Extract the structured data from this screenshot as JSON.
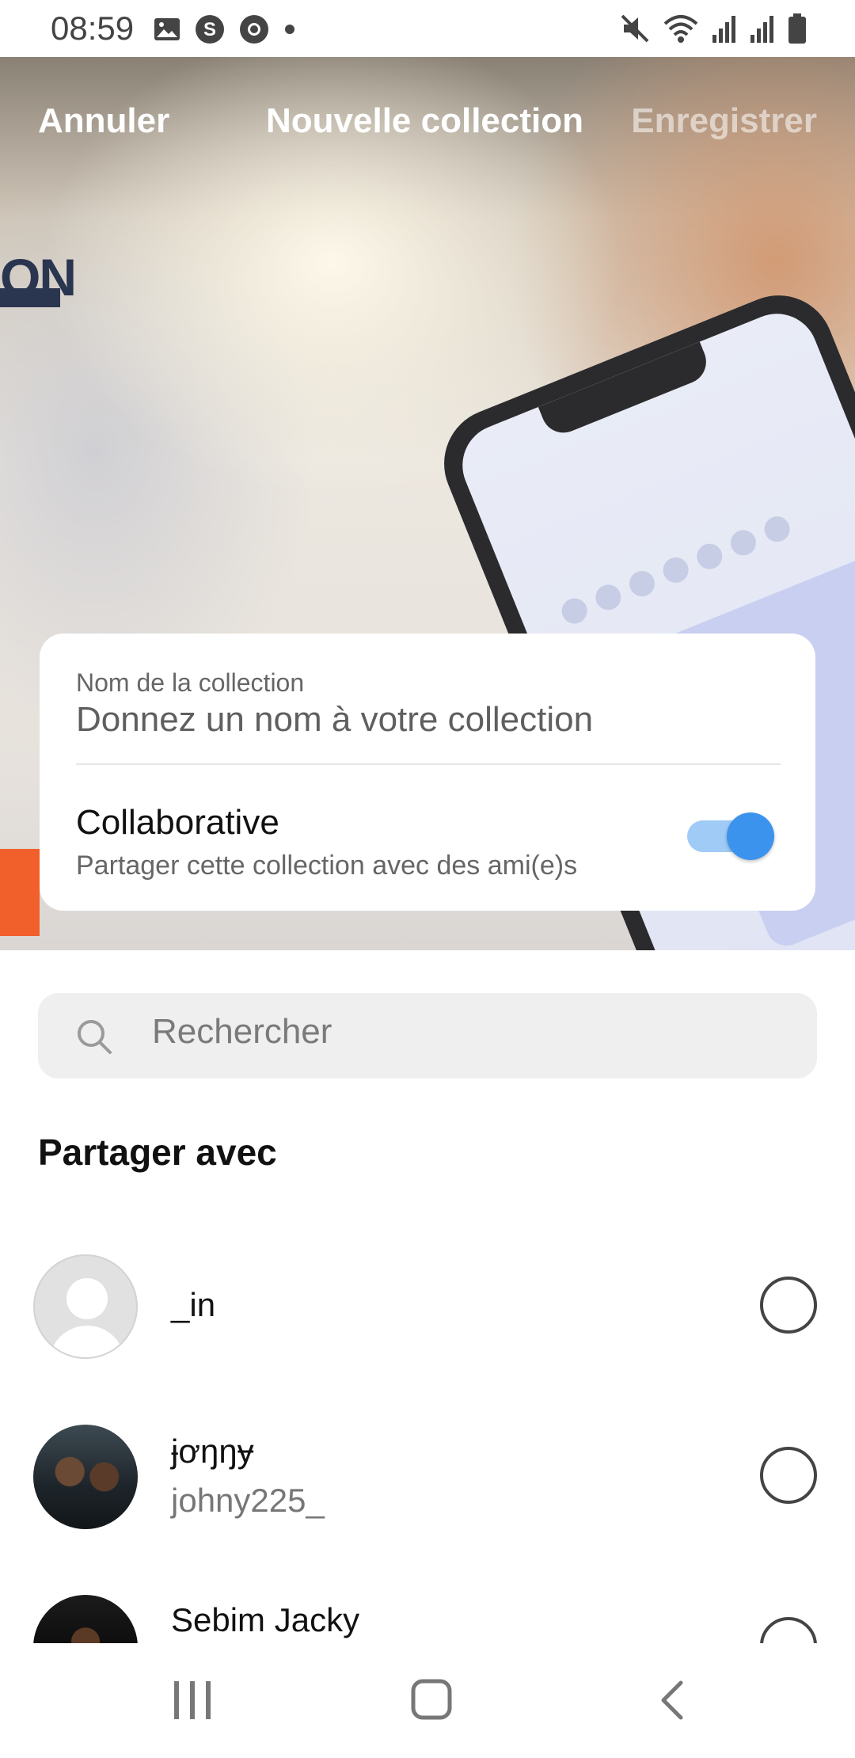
{
  "status_bar": {
    "time": "08:59",
    "left_icons": [
      "image-icon",
      "s-app-icon",
      "chrome-icon",
      "dot-icon"
    ],
    "right_icons": [
      "mute-icon",
      "wifi-icon",
      "signal-icon",
      "signal-icon",
      "battery-icon"
    ]
  },
  "header": {
    "cancel_label": "Annuler",
    "title": "Nouvelle collection",
    "save_label": "Enregistrer"
  },
  "form": {
    "name_label": "Nom de la collection",
    "name_placeholder": "Donnez un nom à votre collection",
    "name_value": "",
    "collaborative_title": "Collaborative",
    "collaborative_subtitle": "Partager cette collection avec des ami(e)s",
    "collaborative_on": true
  },
  "search": {
    "placeholder": "Rechercher"
  },
  "share_section": {
    "title": "Partager avec",
    "contacts": [
      {
        "name": "_in",
        "handle": "",
        "avatar": "default-avatar",
        "selected": false
      },
      {
        "name": "ɉơŋŋɏ",
        "handle": "johny225_",
        "avatar": "photo-avatar",
        "selected": false
      },
      {
        "name": "Sebim Jacky",
        "handle": "",
        "avatar": "photo-avatar",
        "selected": false
      }
    ]
  },
  "colors": {
    "accent": "#3b93ee",
    "toggle_track": "#9fcbf6",
    "search_bg": "#efefef"
  },
  "nav_bar": {
    "buttons": [
      "recent-apps-icon",
      "home-icon",
      "back-icon"
    ]
  }
}
